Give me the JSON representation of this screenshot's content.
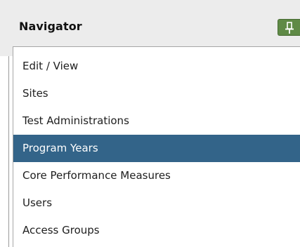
{
  "navigator": {
    "title": "Navigator",
    "pin_icon": "pin-icon",
    "accent_color": "#5f8a46",
    "selected_color": "#336489",
    "items": [
      {
        "label": "Edit / View",
        "selected": false
      },
      {
        "label": "Sites",
        "selected": false
      },
      {
        "label": "Test Administrations",
        "selected": false
      },
      {
        "label": "Program Years",
        "selected": true
      },
      {
        "label": "Core Performance Measures",
        "selected": false
      },
      {
        "label": "Users",
        "selected": false
      },
      {
        "label": "Access Groups",
        "selected": false
      }
    ]
  }
}
